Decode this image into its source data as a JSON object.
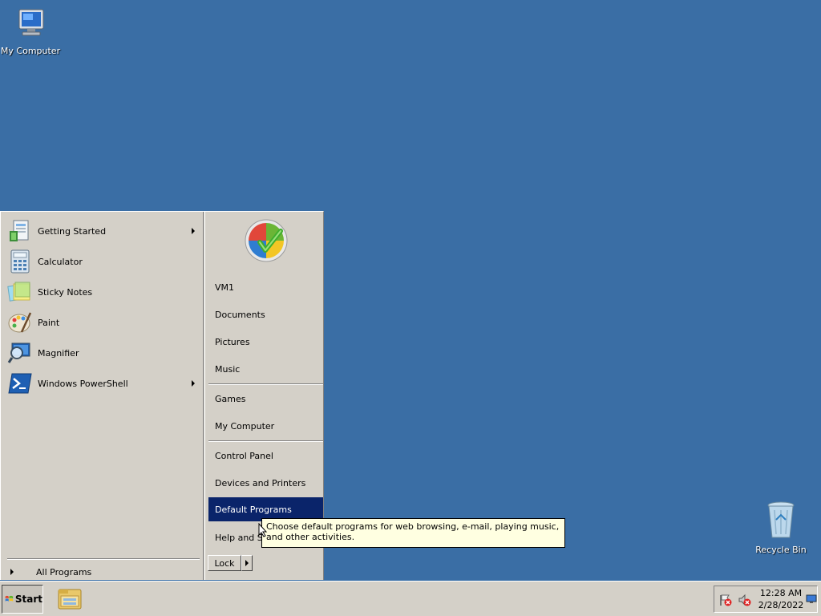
{
  "desktop": {
    "icons": [
      {
        "label": "My Computer",
        "icon": "computer-icon"
      },
      {
        "label": "Recycle Bin",
        "icon": "recycle-bin-icon"
      }
    ],
    "background_color": "#3a6ea5"
  },
  "start_menu": {
    "programs": [
      {
        "label": "Getting Started",
        "icon": "getting-started-icon",
        "has_submenu": true
      },
      {
        "label": "Calculator",
        "icon": "calculator-icon",
        "has_submenu": false
      },
      {
        "label": "Sticky Notes",
        "icon": "sticky-notes-icon",
        "has_submenu": false
      },
      {
        "label": "Paint",
        "icon": "paint-icon",
        "has_submenu": false
      },
      {
        "label": "Magnifier",
        "icon": "magnifier-icon",
        "has_submenu": false
      },
      {
        "label": "Windows PowerShell",
        "icon": "powershell-icon",
        "has_submenu": true
      }
    ],
    "all_programs": "All Programs",
    "places": [
      {
        "label": "VM1"
      },
      {
        "label": "Documents"
      },
      {
        "label": "Pictures"
      },
      {
        "label": "Music"
      },
      {
        "label": "Games"
      },
      {
        "label": "My Computer"
      },
      {
        "label": "Control Panel"
      },
      {
        "label": "Devices and Printers"
      },
      {
        "label": "Default Programs",
        "selected": true
      },
      {
        "label": "Help and Support"
      }
    ],
    "lock_label": "Lock",
    "selected_color": "#0a246a"
  },
  "tooltip": {
    "text": "Choose default programs for web browsing, e-mail, playing music, and other activities."
  },
  "taskbar": {
    "start_label": "Start",
    "clock_time": "12:28 AM",
    "clock_date": "2/28/2022"
  }
}
